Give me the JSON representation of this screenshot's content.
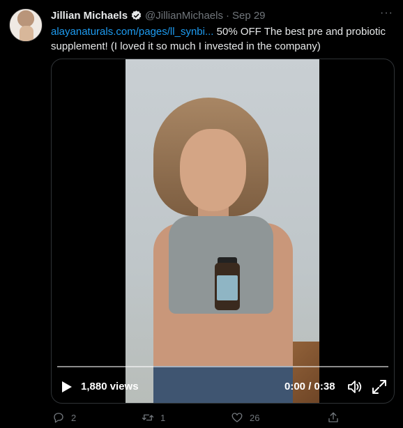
{
  "tweet": {
    "author_name": "Jillian Michaels",
    "handle": "@JillianMichaels",
    "separator": "·",
    "date": "Sep 29",
    "more_label": "···",
    "link_text": "alayanaturals.com/pages/ll_synbi...",
    "body_text": " 50% OFF The best pre and probiotic supplement! (I loved it so much I invested in the company)"
  },
  "video": {
    "views": "1,880 views",
    "time": "0:00 / 0:38",
    "progress": 0
  },
  "actions": {
    "reply_count": "2",
    "retweet_count": "1",
    "like_count": "26"
  },
  "colors": {
    "background": "#000000",
    "link": "#1d9bf0",
    "muted": "#71767b",
    "verified": "#1d9bf0"
  },
  "icons": [
    "verified-badge-icon",
    "more-icon",
    "play-icon",
    "volume-icon",
    "fullscreen-icon",
    "reply-icon",
    "retweet-icon",
    "like-icon",
    "share-icon"
  ]
}
